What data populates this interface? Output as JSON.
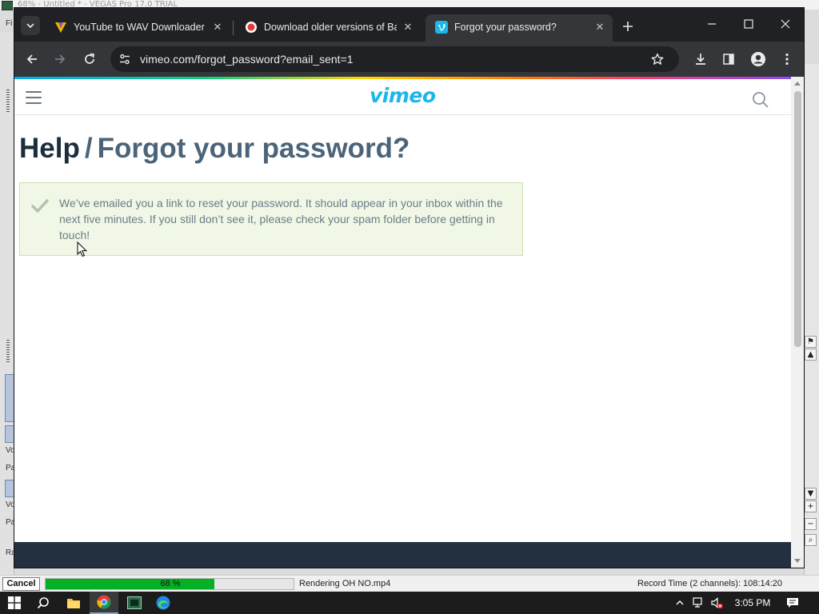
{
  "background_app": {
    "title": "68% - Untitled * - VEGAS Pro 17.0 TRIAL",
    "menu_hint": "Fi",
    "left_labels": [
      "Vo",
      "Pa",
      "Vo",
      "Pa",
      "Ra"
    ]
  },
  "vegas_status": {
    "cancel_label": "Cancel",
    "progress_text": "68 %",
    "progress_value": 68,
    "rendering_text": "Rendering OH NO.mp4",
    "record_time": "Record Time (2 channels): 108:14:20"
  },
  "browser": {
    "tabs": [
      {
        "title": "YouTube to WAV Downloader",
        "favicon": "v-logo-icon",
        "active": false
      },
      {
        "title": "Download older versions of Ban",
        "favicon": "record-icon",
        "active": false
      },
      {
        "title": "Forgot your password?",
        "favicon": "vimeo-icon",
        "active": true
      }
    ],
    "url": "vimeo.com/forgot_password?email_sent=1"
  },
  "page": {
    "logo": "vimeo",
    "breadcrumb_root": "Help",
    "breadcrumb_separator": "/",
    "heading": "Forgot your password?",
    "alert_message": "We’ve emailed you a link to reset your password. It should appear in your inbox within the next five minutes. If you still don’t see it, please check your spam folder before getting in touch!"
  },
  "taskbar": {
    "clock": "3:05 PM"
  },
  "colors": {
    "vimeo_blue": "#1ab7ea",
    "alert_bg": "#f0f7e6",
    "heading": "#1a2e3b",
    "progress_green": "#06b025"
  }
}
